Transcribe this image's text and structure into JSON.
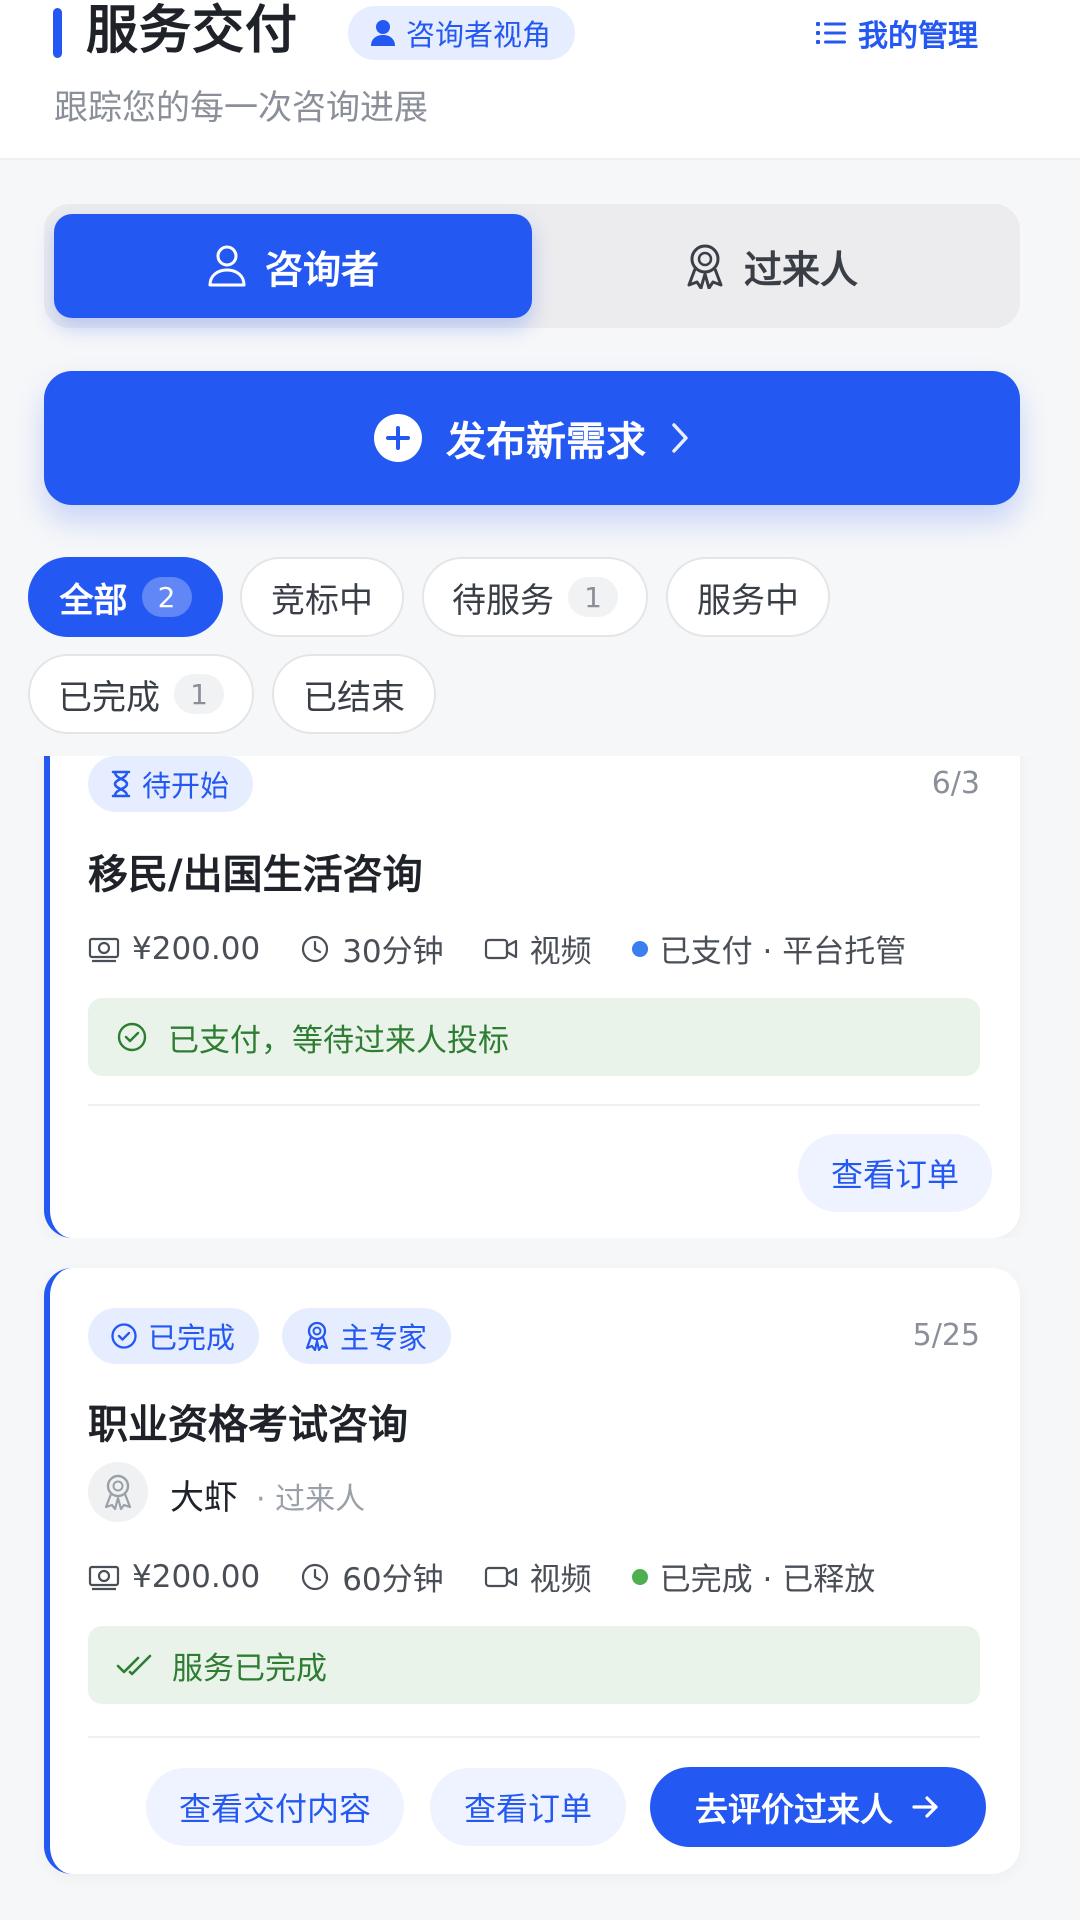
{
  "header": {
    "title": "服务交付",
    "view_chip": "咨询者视角",
    "manage_label": "我的管理",
    "subtitle": "跟踪您的每一次咨询进展"
  },
  "roles": [
    {
      "label": "咨询者",
      "active": true,
      "icon": "person-icon"
    },
    {
      "label": "过来人",
      "active": false,
      "icon": "award-icon"
    }
  ],
  "publish": {
    "label": "发布新需求"
  },
  "filters": [
    {
      "label": "全部",
      "count": "2",
      "active": true
    },
    {
      "label": "竞标中",
      "count": ""
    },
    {
      "label": "待服务",
      "count": "1"
    },
    {
      "label": "服务中",
      "count": ""
    },
    {
      "label": "已完成",
      "count": "1"
    },
    {
      "label": "已结束",
      "count": ""
    }
  ],
  "orders": [
    {
      "status": "待开始",
      "date": "6/3",
      "title": "移民/出国生活咨询",
      "price": "¥200.00",
      "duration": "30分钟",
      "mode": "视频",
      "payment": "已支付 · 平台托管",
      "payment_color": "#3b7ef0",
      "notice": "已支付，等待过来人投标",
      "actions": [
        "查看订单"
      ]
    },
    {
      "status": "已完成",
      "role_tag": "主专家",
      "date": "5/25",
      "title": "职业资格考试咨询",
      "expert_name": "大虾",
      "expert_role": "· 过来人",
      "price": "¥200.00",
      "duration": "60分钟",
      "mode": "视频",
      "payment": "已完成 · 已释放",
      "payment_color": "#4caf50",
      "notice": "服务已完成",
      "actions": [
        "查看交付内容",
        "查看订单",
        "去评价过来人"
      ]
    }
  ],
  "colors": {
    "accent": "#2458f2",
    "success_text": "#2e7d32",
    "success_bg": "#e9f3ea"
  }
}
